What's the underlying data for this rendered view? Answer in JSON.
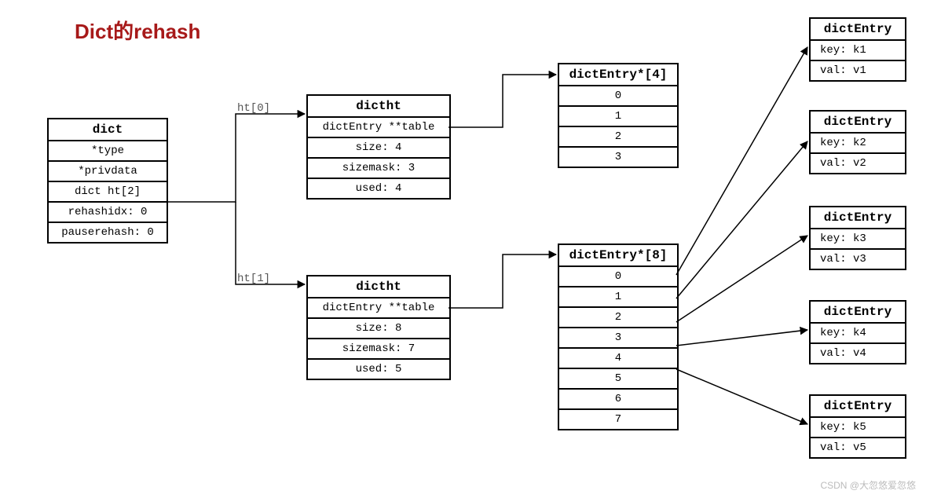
{
  "title": "Dict的rehash",
  "watermark": "CSDN @大忽悠爱忽悠",
  "labels": {
    "ht0": "ht[0]",
    "ht1": "ht[1]"
  },
  "dict": {
    "header": "dict",
    "rows": [
      "*type",
      "*privdata",
      "dict ht[2]",
      "rehashidx: 0",
      "pauserehash: 0"
    ]
  },
  "dictht0": {
    "header": "dictht",
    "rows": [
      "dictEntry **table",
      "size: 4",
      "sizemask: 3",
      "used: 4"
    ]
  },
  "dictht1": {
    "header": "dictht",
    "rows": [
      "dictEntry **table",
      "size: 8",
      "sizemask: 7",
      "used: 5"
    ]
  },
  "array4": {
    "header": "dictEntry*[4]",
    "slots": [
      "0",
      "1",
      "2",
      "3"
    ]
  },
  "array8": {
    "header": "dictEntry*[8]",
    "slots": [
      "0",
      "1",
      "2",
      "3",
      "4",
      "5",
      "6",
      "7"
    ]
  },
  "entries": [
    {
      "header": "dictEntry",
      "key": "key: k1",
      "val": "val: v1"
    },
    {
      "header": "dictEntry",
      "key": "key: k2",
      "val": "val: v2"
    },
    {
      "header": "dictEntry",
      "key": "key: k3",
      "val": "val: v3"
    },
    {
      "header": "dictEntry",
      "key": "key: k4",
      "val": "val: v4"
    },
    {
      "header": "dictEntry",
      "key": "key: k5",
      "val": "val: v5"
    }
  ]
}
